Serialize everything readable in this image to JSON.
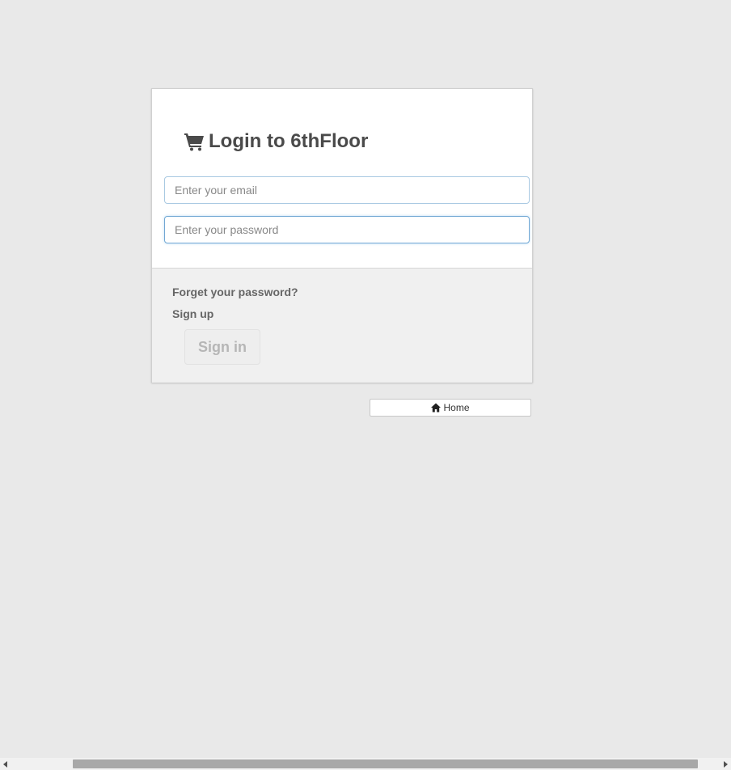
{
  "login": {
    "title": "Login to 6thFloor",
    "title_icon": "shopping-cart-icon",
    "email_placeholder": "Enter your email",
    "email_value": "",
    "password_placeholder": "Enter your password",
    "password_value": "",
    "forgot_link": "Forget your password?",
    "signup_link": "Sign up",
    "signin_button": "Sign in"
  },
  "nav": {
    "home_label": "Home",
    "home_icon": "home-icon"
  },
  "colors": {
    "page_background": "#e9e9e9",
    "card_background": "#ffffff",
    "footer_background": "#f0f0f0",
    "focus_border": "#72a8d4",
    "title_text": "#4a4a4a",
    "disabled_button_text": "#b6b6b6"
  }
}
